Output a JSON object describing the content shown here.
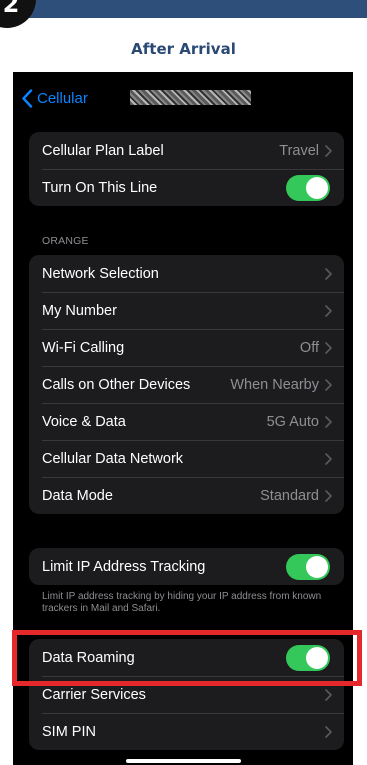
{
  "step_number": "2",
  "caption": "After Arrival",
  "nav": {
    "back_label": "Cellular"
  },
  "group1": [
    {
      "label": "Cellular Plan Label",
      "value": "Travel"
    },
    {
      "label": "Turn On This Line",
      "toggle_on": true
    }
  ],
  "section_header": "ORANGE",
  "group2": [
    {
      "label": "Network Selection",
      "value": ""
    },
    {
      "label": "My Number",
      "value": ""
    },
    {
      "label": "Wi-Fi Calling",
      "value": "Off"
    },
    {
      "label": "Calls on Other Devices",
      "value": "When Nearby"
    },
    {
      "label": "Voice & Data",
      "value": "5G Auto"
    },
    {
      "label": "Cellular Data Network",
      "value": ""
    },
    {
      "label": "Data Mode",
      "value": "Standard"
    }
  ],
  "group3": [
    {
      "label": "Limit IP Address Tracking",
      "toggle_on": true
    }
  ],
  "footnote": "Limit IP address tracking by hiding your IP address from known trackers in Mail and Safari.",
  "group4": [
    {
      "label": "Data Roaming",
      "toggle_on": true
    },
    {
      "label": "Carrier Services",
      "value": ""
    },
    {
      "label": "SIM PIN",
      "value": ""
    }
  ],
  "colors": {
    "band": "#2e4f79",
    "caption": "#2a4a73",
    "toggle_on": "#34c759",
    "link": "#0a84ff",
    "highlight": "#e5282b"
  },
  "icons": {
    "back": "chevron-left-icon",
    "disclosure": "chevron-right-icon"
  }
}
